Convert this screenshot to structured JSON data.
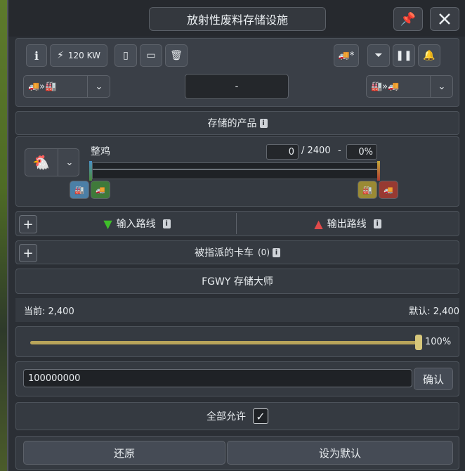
{
  "window_title": "放射性废料存储设施",
  "power": "120 KW",
  "mode_display": "-",
  "storage_section": "存储的产品",
  "product_name": "整鸡",
  "quantity": "0",
  "capacity": "/ 2400",
  "separator": "-",
  "percent": "0%",
  "input_routes": "输入路线",
  "output_routes": "输出路线",
  "assigned_trucks": "被指派的卡车",
  "assigned_trucks_count": "(0)",
  "mod_title": "FGWY 存储大师",
  "current_label": "当前: 2,400",
  "default_label": "默认: 2,400",
  "slider_value": "100%",
  "slider_fraction": 1.0,
  "capacity_input_value": "100000000",
  "confirm": "确认",
  "allow_all": "全部允许",
  "allow_all_checked": true,
  "restore": "还原",
  "set_default": "设为默认",
  "info_glyph": "i",
  "plus_glyph": "+"
}
